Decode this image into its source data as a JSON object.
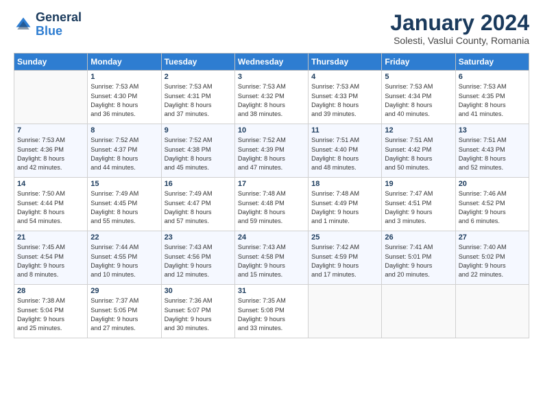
{
  "logo": {
    "line1": "General",
    "line2": "Blue"
  },
  "title": "January 2024",
  "subtitle": "Solesti, Vaslui County, Romania",
  "days_of_week": [
    "Sunday",
    "Monday",
    "Tuesday",
    "Wednesday",
    "Thursday",
    "Friday",
    "Saturday"
  ],
  "weeks": [
    [
      {
        "day": "",
        "info": ""
      },
      {
        "day": "1",
        "info": "Sunrise: 7:53 AM\nSunset: 4:30 PM\nDaylight: 8 hours\nand 36 minutes."
      },
      {
        "day": "2",
        "info": "Sunrise: 7:53 AM\nSunset: 4:31 PM\nDaylight: 8 hours\nand 37 minutes."
      },
      {
        "day": "3",
        "info": "Sunrise: 7:53 AM\nSunset: 4:32 PM\nDaylight: 8 hours\nand 38 minutes."
      },
      {
        "day": "4",
        "info": "Sunrise: 7:53 AM\nSunset: 4:33 PM\nDaylight: 8 hours\nand 39 minutes."
      },
      {
        "day": "5",
        "info": "Sunrise: 7:53 AM\nSunset: 4:34 PM\nDaylight: 8 hours\nand 40 minutes."
      },
      {
        "day": "6",
        "info": "Sunrise: 7:53 AM\nSunset: 4:35 PM\nDaylight: 8 hours\nand 41 minutes."
      }
    ],
    [
      {
        "day": "7",
        "info": "Sunrise: 7:53 AM\nSunset: 4:36 PM\nDaylight: 8 hours\nand 42 minutes."
      },
      {
        "day": "8",
        "info": "Sunrise: 7:52 AM\nSunset: 4:37 PM\nDaylight: 8 hours\nand 44 minutes."
      },
      {
        "day": "9",
        "info": "Sunrise: 7:52 AM\nSunset: 4:38 PM\nDaylight: 8 hours\nand 45 minutes."
      },
      {
        "day": "10",
        "info": "Sunrise: 7:52 AM\nSunset: 4:39 PM\nDaylight: 8 hours\nand 47 minutes."
      },
      {
        "day": "11",
        "info": "Sunrise: 7:51 AM\nSunset: 4:40 PM\nDaylight: 8 hours\nand 48 minutes."
      },
      {
        "day": "12",
        "info": "Sunrise: 7:51 AM\nSunset: 4:42 PM\nDaylight: 8 hours\nand 50 minutes."
      },
      {
        "day": "13",
        "info": "Sunrise: 7:51 AM\nSunset: 4:43 PM\nDaylight: 8 hours\nand 52 minutes."
      }
    ],
    [
      {
        "day": "14",
        "info": "Sunrise: 7:50 AM\nSunset: 4:44 PM\nDaylight: 8 hours\nand 54 minutes."
      },
      {
        "day": "15",
        "info": "Sunrise: 7:49 AM\nSunset: 4:45 PM\nDaylight: 8 hours\nand 55 minutes."
      },
      {
        "day": "16",
        "info": "Sunrise: 7:49 AM\nSunset: 4:47 PM\nDaylight: 8 hours\nand 57 minutes."
      },
      {
        "day": "17",
        "info": "Sunrise: 7:48 AM\nSunset: 4:48 PM\nDaylight: 8 hours\nand 59 minutes."
      },
      {
        "day": "18",
        "info": "Sunrise: 7:48 AM\nSunset: 4:49 PM\nDaylight: 9 hours\nand 1 minute."
      },
      {
        "day": "19",
        "info": "Sunrise: 7:47 AM\nSunset: 4:51 PM\nDaylight: 9 hours\nand 3 minutes."
      },
      {
        "day": "20",
        "info": "Sunrise: 7:46 AM\nSunset: 4:52 PM\nDaylight: 9 hours\nand 6 minutes."
      }
    ],
    [
      {
        "day": "21",
        "info": "Sunrise: 7:45 AM\nSunset: 4:54 PM\nDaylight: 9 hours\nand 8 minutes."
      },
      {
        "day": "22",
        "info": "Sunrise: 7:44 AM\nSunset: 4:55 PM\nDaylight: 9 hours\nand 10 minutes."
      },
      {
        "day": "23",
        "info": "Sunrise: 7:43 AM\nSunset: 4:56 PM\nDaylight: 9 hours\nand 12 minutes."
      },
      {
        "day": "24",
        "info": "Sunrise: 7:43 AM\nSunset: 4:58 PM\nDaylight: 9 hours\nand 15 minutes."
      },
      {
        "day": "25",
        "info": "Sunrise: 7:42 AM\nSunset: 4:59 PM\nDaylight: 9 hours\nand 17 minutes."
      },
      {
        "day": "26",
        "info": "Sunrise: 7:41 AM\nSunset: 5:01 PM\nDaylight: 9 hours\nand 20 minutes."
      },
      {
        "day": "27",
        "info": "Sunrise: 7:40 AM\nSunset: 5:02 PM\nDaylight: 9 hours\nand 22 minutes."
      }
    ],
    [
      {
        "day": "28",
        "info": "Sunrise: 7:38 AM\nSunset: 5:04 PM\nDaylight: 9 hours\nand 25 minutes."
      },
      {
        "day": "29",
        "info": "Sunrise: 7:37 AM\nSunset: 5:05 PM\nDaylight: 9 hours\nand 27 minutes."
      },
      {
        "day": "30",
        "info": "Sunrise: 7:36 AM\nSunset: 5:07 PM\nDaylight: 9 hours\nand 30 minutes."
      },
      {
        "day": "31",
        "info": "Sunrise: 7:35 AM\nSunset: 5:08 PM\nDaylight: 9 hours\nand 33 minutes."
      },
      {
        "day": "",
        "info": ""
      },
      {
        "day": "",
        "info": ""
      },
      {
        "day": "",
        "info": ""
      }
    ]
  ]
}
